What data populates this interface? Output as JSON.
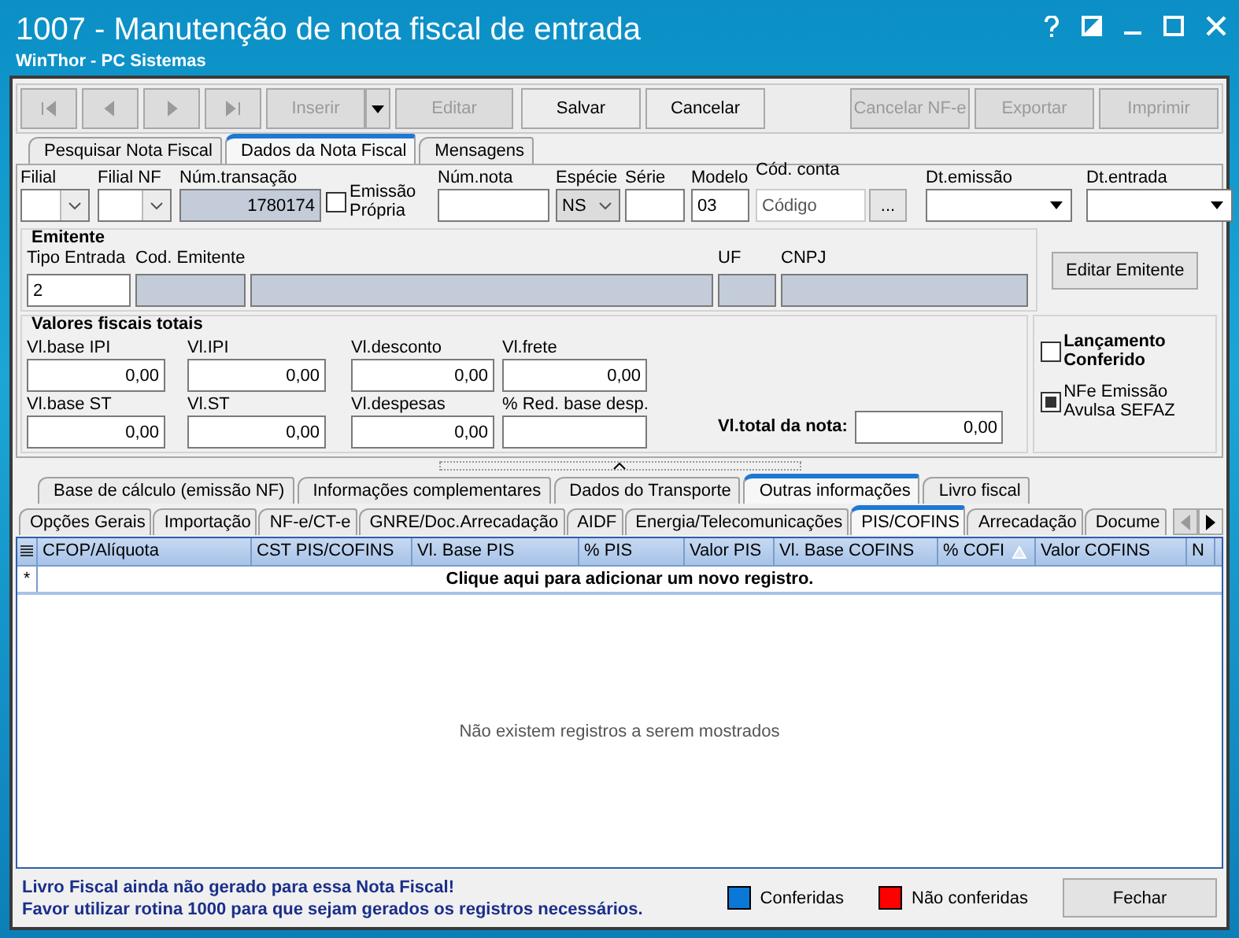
{
  "window": {
    "title": "1007 - Manutenção de nota fiscal de entrada",
    "subtitle": "WinThor - PC Sistemas"
  },
  "toolbar_left": [
    {
      "kind": "first",
      "disabled": true
    },
    {
      "kind": "prev",
      "disabled": true
    },
    {
      "kind": "next",
      "disabled": true
    },
    {
      "kind": "last",
      "disabled": true
    },
    {
      "kind": "split",
      "label": "Inserir",
      "disabled": true
    },
    {
      "kind": "text",
      "label": "Editar",
      "disabled": true
    },
    {
      "kind": "text",
      "label": "Salvar",
      "disabled": false
    },
    {
      "kind": "text",
      "label": "Cancelar",
      "disabled": false
    }
  ],
  "toolbar_right": [
    {
      "kind": "text",
      "label": "Cancelar NF-e",
      "disabled": true
    },
    {
      "kind": "text",
      "label": "Exportar",
      "disabled": true
    },
    {
      "kind": "text",
      "label": "Imprimir",
      "disabled": true
    }
  ],
  "main_tabs": [
    {
      "label": "Pesquisar Nota Fiscal",
      "selected": false
    },
    {
      "label": "Dados da Nota Fiscal",
      "selected": true
    },
    {
      "label": "Mensagens",
      "selected": false
    }
  ],
  "header_fields": [
    {
      "kind": "combo",
      "label": "Filial"
    },
    {
      "kind": "combo",
      "label": "Filial NF"
    },
    {
      "kind": "readonly",
      "label": "Núm.transação",
      "value": "1780174"
    },
    {
      "kind": "check",
      "label": "Emissão Própria",
      "checked": false
    },
    {
      "kind": "text",
      "label": "Núm.nota"
    },
    {
      "kind": "greycombo",
      "label": "Espécie",
      "value": "NS"
    },
    {
      "kind": "text",
      "label": "Série"
    },
    {
      "kind": "text",
      "label": "Modelo",
      "value": "03"
    },
    {
      "kind": "lookup",
      "label": "Cód. conta",
      "placeholder": "Código",
      "button": "..."
    },
    {
      "kind": "date",
      "label": "Dt.emissão"
    },
    {
      "kind": "date",
      "label": "Dt.entrada"
    }
  ],
  "emitente": {
    "title": "Emitente",
    "fields": [
      {
        "label": "Tipo Entrada",
        "value": "2",
        "readonly": false
      },
      {
        "label": "Cod. Emitente",
        "readonly": true
      },
      {
        "readonly": true
      },
      {
        "label": "UF",
        "readonly": true
      },
      {
        "label": "CNPJ",
        "readonly": true
      }
    ],
    "button": "Editar Emitente"
  },
  "valores": {
    "title": "Valores fiscais totais",
    "rows": [
      [
        {
          "label": "Vl.base IPI",
          "value": "0,00"
        },
        {
          "label": "Vl.IPI",
          "value": "0,00"
        },
        {
          "label": "Vl.desconto",
          "value": "0,00"
        },
        {
          "label": "Vl.frete",
          "value": "0,00"
        }
      ],
      [
        {
          "label": "Vl.base ST",
          "value": "0,00"
        },
        {
          "label": "Vl.ST",
          "value": "0,00"
        },
        {
          "label": "Vl.despesas",
          "value": "0,00"
        },
        {
          "label": "% Red. base desp."
        }
      ]
    ],
    "total_label": "Vl.total da nota:",
    "total_value": "0,00"
  },
  "flags": [
    {
      "label": "Lançamento Conferido",
      "checked": false,
      "bold": true
    },
    {
      "label": "NFe Emissão Avulsa SEFAZ",
      "checked": true,
      "bold": false
    }
  ],
  "tabs_back": [
    {
      "label": "Base de cálculo (emissão NF)",
      "selected": false
    },
    {
      "label": "Informações complementares",
      "selected": false
    },
    {
      "label": "Dados do Transporte",
      "selected": false
    },
    {
      "label": "Outras informações",
      "selected": true
    },
    {
      "label": "Livro fiscal",
      "selected": false
    }
  ],
  "tabs_front": [
    {
      "label": "Opções Gerais",
      "selected": false
    },
    {
      "label": "Importação",
      "selected": false
    },
    {
      "label": "NF-e/CT-e",
      "selected": false
    },
    {
      "label": "GNRE/Doc.Arrecadação",
      "selected": false
    },
    {
      "label": "AIDF",
      "selected": false
    },
    {
      "label": "Energia/Telecomunicações",
      "selected": false
    },
    {
      "label": "PIS/COFINS",
      "selected": true
    },
    {
      "label": "Arrecadação",
      "selected": false
    },
    {
      "label": "Docume",
      "selected": false
    }
  ],
  "table": {
    "columns": [
      {
        "label": "CFOP/Alíquota",
        "sorted": false
      },
      {
        "label": "CST PIS/COFINS",
        "sorted": false
      },
      {
        "label": "Vl. Base PIS",
        "sorted": false
      },
      {
        "label": "% PIS",
        "sorted": false
      },
      {
        "label": "Valor PIS",
        "sorted": false
      },
      {
        "label": "Vl. Base COFINS",
        "sorted": false
      },
      {
        "label": "% COFI",
        "sorted": true
      },
      {
        "label": "Valor COFINS",
        "sorted": false
      },
      {
        "label": "N",
        "sorted": false
      }
    ],
    "new_row_marker": "*",
    "new_row_text": "Clique aqui para adicionar um novo registro.",
    "empty_text": "Não existem registros a serem mostrados"
  },
  "footer": {
    "messages": [
      "Livro Fiscal ainda não gerado para essa Nota Fiscal!",
      "Favor utilizar rotina 1000 para que sejam gerados os registros necessários."
    ],
    "legend": [
      {
        "label": "Conferidas",
        "color": "#0a78d7"
      },
      {
        "label": "Não conferidas",
        "color": "#ff0000"
      }
    ],
    "close_button": "Fechar"
  }
}
